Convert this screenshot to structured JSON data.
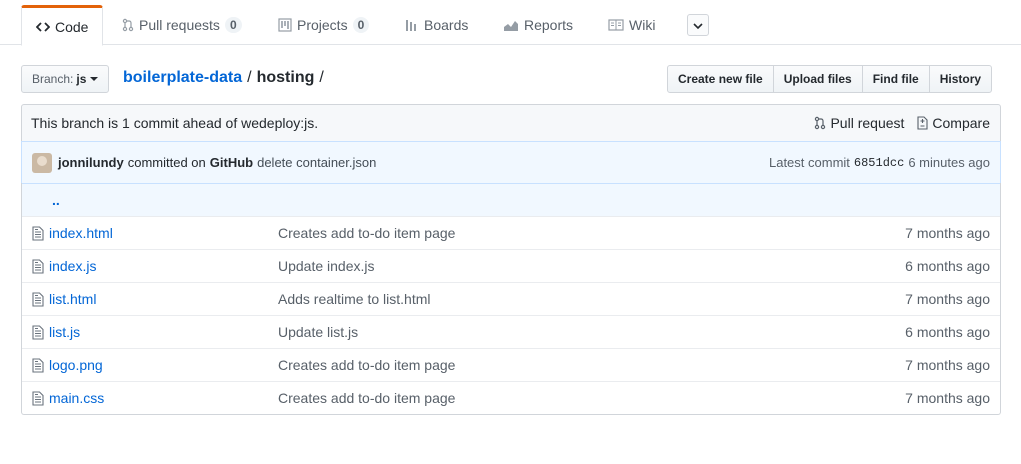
{
  "tabs": [
    {
      "label": "Code",
      "icon": "code-icon",
      "selected": true
    },
    {
      "label": "Pull requests",
      "icon": "pull-request-icon",
      "count": "0"
    },
    {
      "label": "Projects",
      "icon": "project-icon",
      "count": "0"
    },
    {
      "label": "Boards",
      "icon": "boards-icon"
    },
    {
      "label": "Reports",
      "icon": "graph-icon"
    },
    {
      "label": "Wiki",
      "icon": "book-icon"
    }
  ],
  "branch": {
    "prefix": "Branch:",
    "name": "js"
  },
  "breadcrumb": {
    "repo": "boilerplate-data",
    "sep1": "/",
    "folder": "hosting",
    "sep2": "/"
  },
  "actions": {
    "create": "Create new file",
    "upload": "Upload files",
    "find": "Find file",
    "history": "History"
  },
  "branch_info": {
    "text": "This branch is 1 commit ahead of wedeploy:js.",
    "pull_request": "Pull request",
    "compare": "Compare"
  },
  "commit": {
    "author": "jonnilundy",
    "verb": "committed on",
    "platform": "GitHub",
    "message": "delete container.json",
    "latest_label": "Latest commit",
    "sha": "6851dcc",
    "age": "6 minutes ago"
  },
  "parent_dir": "..",
  "files": [
    {
      "name": "index.html",
      "message": "Creates add to-do item page",
      "age": "7 months ago"
    },
    {
      "name": "index.js",
      "message": "Update index.js",
      "age": "6 months ago"
    },
    {
      "name": "list.html",
      "message": "Adds realtime to list.html",
      "age": "7 months ago"
    },
    {
      "name": "list.js",
      "message": "Update list.js",
      "age": "6 months ago"
    },
    {
      "name": "logo.png",
      "message": "Creates add to-do item page",
      "age": "7 months ago"
    },
    {
      "name": "main.css",
      "message": "Creates add to-do item page",
      "age": "7 months ago"
    }
  ]
}
